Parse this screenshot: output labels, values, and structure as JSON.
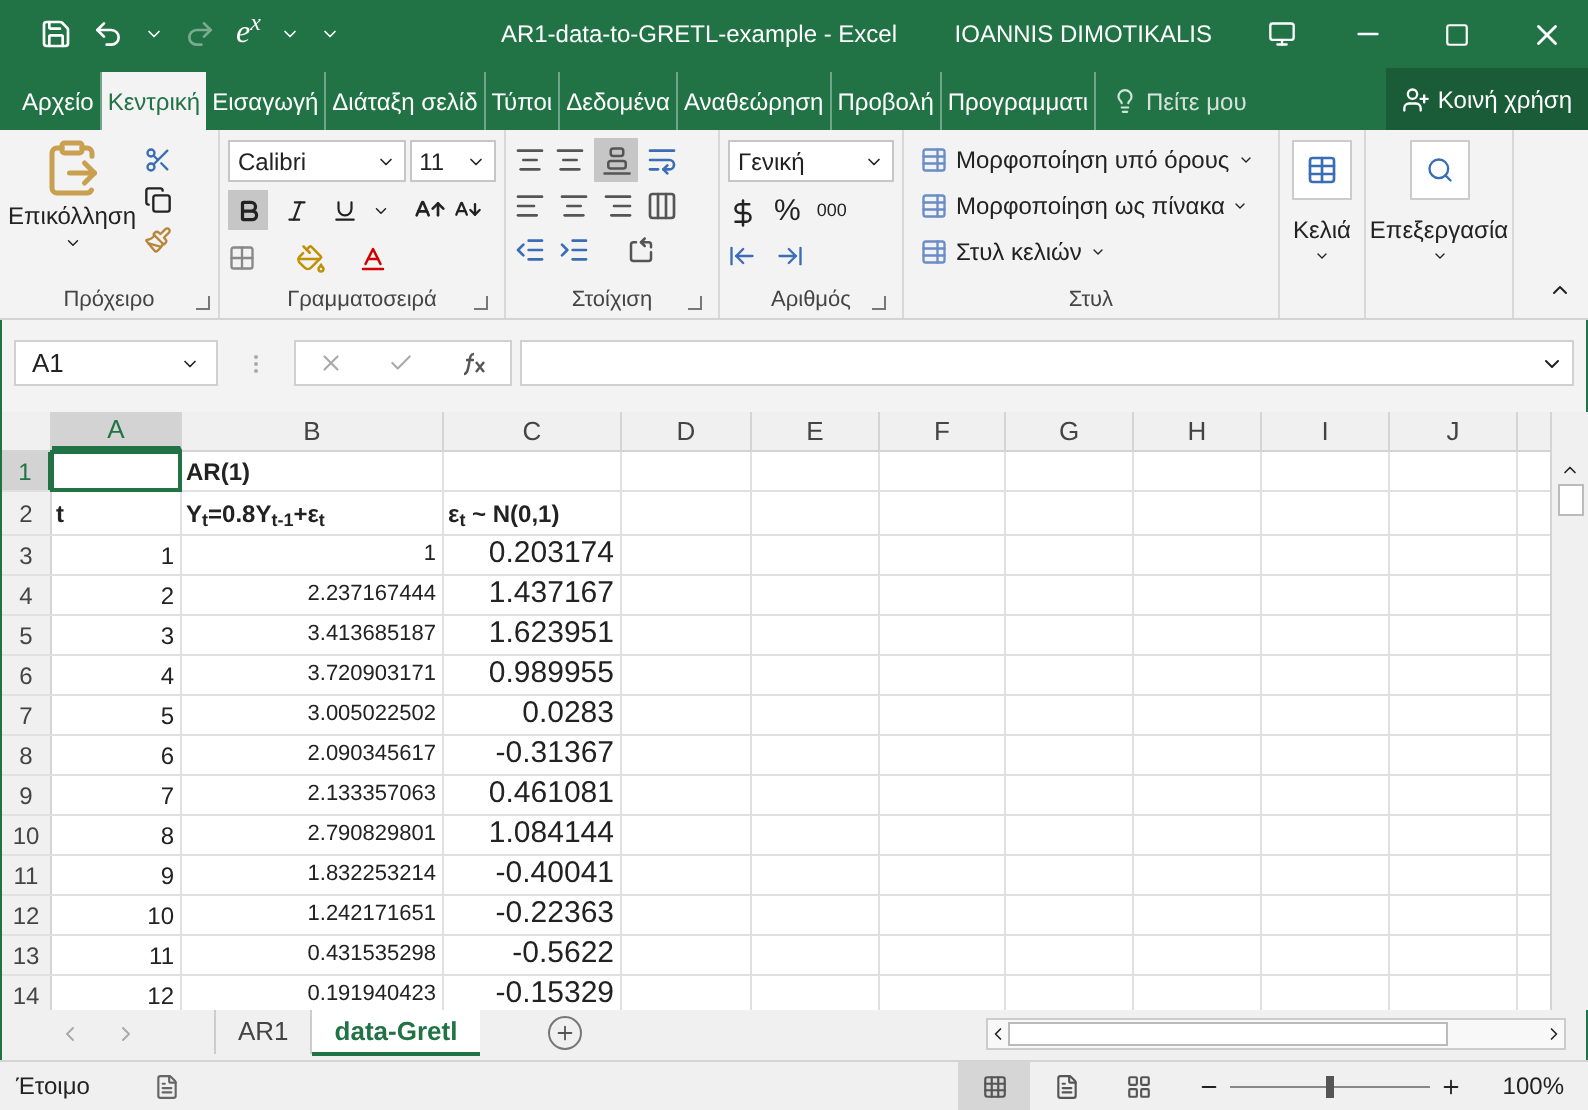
{
  "title_bar": {
    "equation_button": "e$^{x}$",
    "title": "AR1-data-to-GRETL-example - Excel",
    "user": "IOANNIS DIMOTIKALIS"
  },
  "ribbon_tabs": [
    {
      "label": "Αρχείο",
      "selected": false
    },
    {
      "label": "Κεντρική",
      "selected": true
    },
    {
      "label": "Εισαγωγή",
      "selected": false
    },
    {
      "label": "Διάταξη σελίδ",
      "selected": false
    },
    {
      "label": "Τύποι",
      "selected": false
    },
    {
      "label": "Δεδομένα",
      "selected": false
    },
    {
      "label": "Αναθεώρηση",
      "selected": false
    },
    {
      "label": "Προβολή",
      "selected": false
    },
    {
      "label": "Προγραμματι",
      "selected": false
    }
  ],
  "tell_me": {
    "placeholder": "Πείτε μου"
  },
  "share_button": "Κοινή χρήση",
  "clipboard": {
    "paste": "Επικόλληση",
    "label": "Πρόχειρο"
  },
  "font": {
    "name": "Calibri",
    "size": "11",
    "bold": true,
    "italic": false,
    "underline": false,
    "label": "Γραμματοσειρά"
  },
  "alignment": {
    "bottom_align": true,
    "label": "Στοίχιση"
  },
  "number": {
    "format": "Γενική",
    "percent": "%",
    "thousands": "000",
    "label": "Αριθμός"
  },
  "styles": {
    "items": [
      "Μορφοποίηση υπό όρους",
      "Μορφοποίηση ως πίνακα",
      "Στυλ κελιών"
    ],
    "label": "Στυλ"
  },
  "cells_button": "Κελιά",
  "editing_button": "Επεξεργασία",
  "name_box": "A1",
  "columns": [
    {
      "label": "A",
      "selected": true
    },
    {
      "label": "B",
      "selected": false
    },
    {
      "label": "C",
      "selected": false
    },
    {
      "label": "D",
      "selected": false
    },
    {
      "label": "E",
      "selected": false
    },
    {
      "label": "F",
      "selected": false
    },
    {
      "label": "G",
      "selected": false
    },
    {
      "label": "H",
      "selected": false
    },
    {
      "label": "I",
      "selected": false
    },
    {
      "label": "J",
      "selected": false
    }
  ],
  "rows": [
    {
      "number": "1",
      "selected": true,
      "kind": "heading",
      "b": "AR(1)"
    },
    {
      "number": "2",
      "selected": false,
      "kind": "heading",
      "a": "t",
      "b": "Y$_{t}$=0.8Y$_{t-1}$+ε$_{t}$",
      "c": "ε$_{t}$ ~ N(0,1)"
    },
    {
      "number": "3",
      "selected": false,
      "kind": "data",
      "a": "1",
      "b": "1",
      "c": "0.203174"
    },
    {
      "number": "4",
      "selected": false,
      "kind": "data",
      "a": "2",
      "b": "2.237167444",
      "c": "1.437167"
    },
    {
      "number": "5",
      "selected": false,
      "kind": "data",
      "a": "3",
      "b": "3.413685187",
      "c": "1.623951"
    },
    {
      "number": "6",
      "selected": false,
      "kind": "data",
      "a": "4",
      "b": "3.720903171",
      "c": "0.989955"
    },
    {
      "number": "7",
      "selected": false,
      "kind": "data",
      "a": "5",
      "b": "3.005022502",
      "c": "0.0283"
    },
    {
      "number": "8",
      "selected": false,
      "kind": "data",
      "a": "6",
      "b": "2.090345617",
      "c": "-0.31367"
    },
    {
      "number": "9",
      "selected": false,
      "kind": "data",
      "a": "7",
      "b": "2.133357063",
      "c": "0.461081"
    },
    {
      "number": "10",
      "selected": false,
      "kind": "data",
      "a": "8",
      "b": "2.790829801",
      "c": "1.084144"
    },
    {
      "number": "11",
      "selected": false,
      "kind": "data",
      "a": "9",
      "b": "1.832253214",
      "c": "-0.40041"
    },
    {
      "number": "12",
      "selected": false,
      "kind": "data",
      "a": "10",
      "b": "1.242171651",
      "c": "-0.22363"
    },
    {
      "number": "13",
      "selected": false,
      "kind": "data",
      "a": "11",
      "b": "0.431535298",
      "c": "-0.5622"
    },
    {
      "number": "14",
      "selected": false,
      "kind": "data",
      "a": "12",
      "b": "0.191940423",
      "c": "-0.15329"
    }
  ],
  "sheet_tabs": [
    {
      "label": "AR1",
      "selected": false
    },
    {
      "label": "data-Gretl",
      "selected": true
    }
  ],
  "status_bar": {
    "status": "Έτοιμο",
    "views": [
      {
        "kind": "normal",
        "selected": true
      },
      {
        "kind": "layout",
        "selected": false
      },
      {
        "kind": "pagebreak",
        "selected": false
      }
    ],
    "zoom": {
      "level": 0.5
    },
    "zoom_reading": "100%"
  }
}
